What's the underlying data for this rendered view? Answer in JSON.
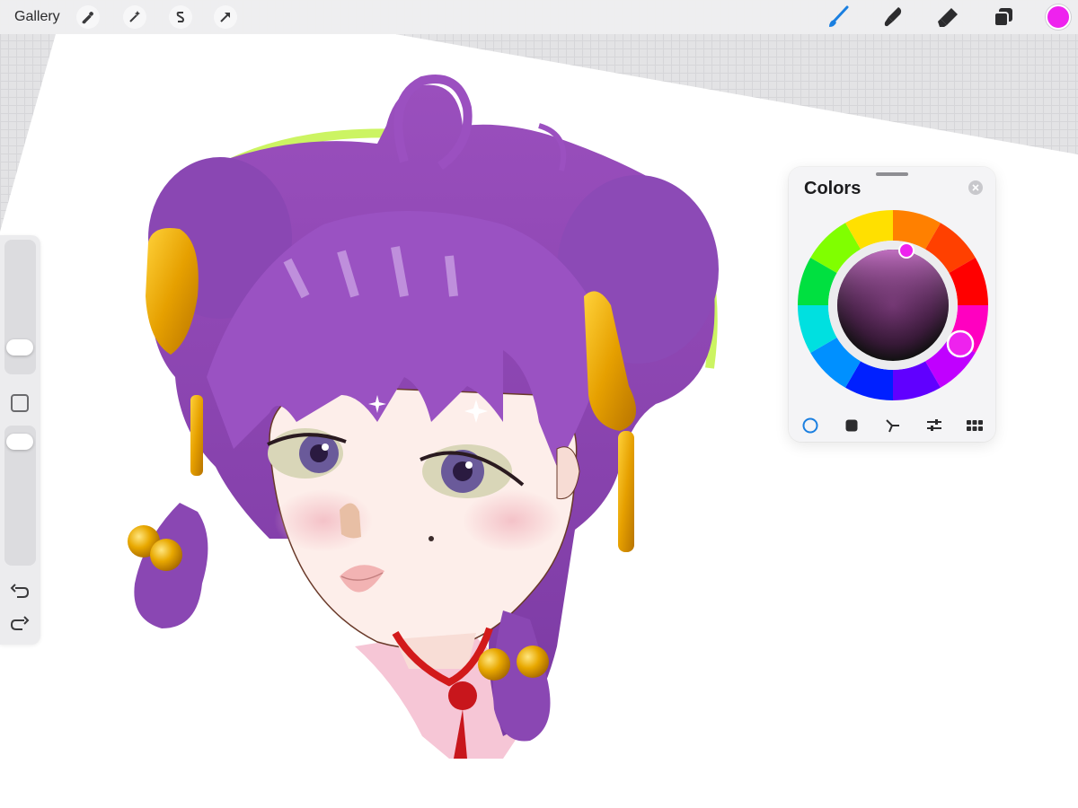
{
  "toolbar": {
    "gallery_label": "Gallery",
    "actions_icon": "wrench-icon",
    "adjustments_icon": "magic-wand-icon",
    "selection_icon": "selection-icon",
    "transform_icon": "arrow-icon",
    "brush_icon": "brush-icon",
    "smudge_icon": "smudge-icon",
    "eraser_icon": "eraser-icon",
    "layers_icon": "layers-icon",
    "current_color": "#ee22ee",
    "active_tool_color": "#1a7fe0"
  },
  "sidebar": {
    "brush_size_icon": "slider",
    "modify_icon": "square-icon",
    "opacity_icon": "slider",
    "undo_icon": "undo-icon",
    "redo_icon": "redo-icon"
  },
  "colors_panel": {
    "title": "Colors",
    "close_icon": "close-icon",
    "selected_color": "#ee22ee",
    "modes": [
      {
        "name": "disc",
        "icon": "circle-icon",
        "active": true
      },
      {
        "name": "classic",
        "icon": "square-icon",
        "active": false
      },
      {
        "name": "harmony",
        "icon": "harmony-icon",
        "active": false
      },
      {
        "name": "value",
        "icon": "sliders-icon",
        "active": false
      },
      {
        "name": "palettes",
        "icon": "grid-icon",
        "active": false
      }
    ]
  }
}
